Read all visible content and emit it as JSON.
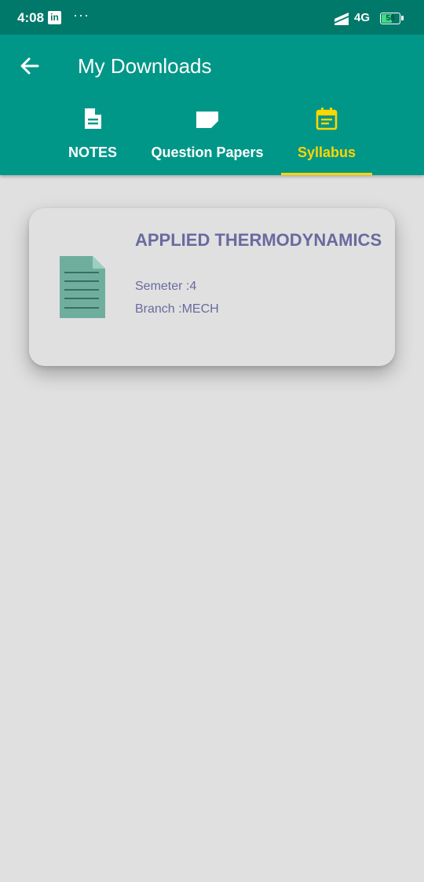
{
  "status_bar": {
    "time": "4:08",
    "linkedin_badge": "in",
    "overflow": "···",
    "network": "4G",
    "battery": "58",
    "battery_level": 0.58
  },
  "app_bar": {
    "back_icon": "arrow-left-icon",
    "title": "My Downloads",
    "background_color": "#009688"
  },
  "tabs": [
    {
      "label": "NOTES",
      "icon": "document-icon",
      "active": false
    },
    {
      "label": "Question Papers",
      "icon": "folded-paper-icon",
      "active": false
    },
    {
      "label": "Syllabus",
      "icon": "calendar-icon",
      "active": true
    }
  ],
  "accent_color": "#ffd600",
  "downloads": [
    {
      "icon": "file-icon",
      "title": "APPLIED THERMODYNAMICS",
      "semester": "Semeter :4",
      "branch": "Branch :MECH"
    }
  ]
}
